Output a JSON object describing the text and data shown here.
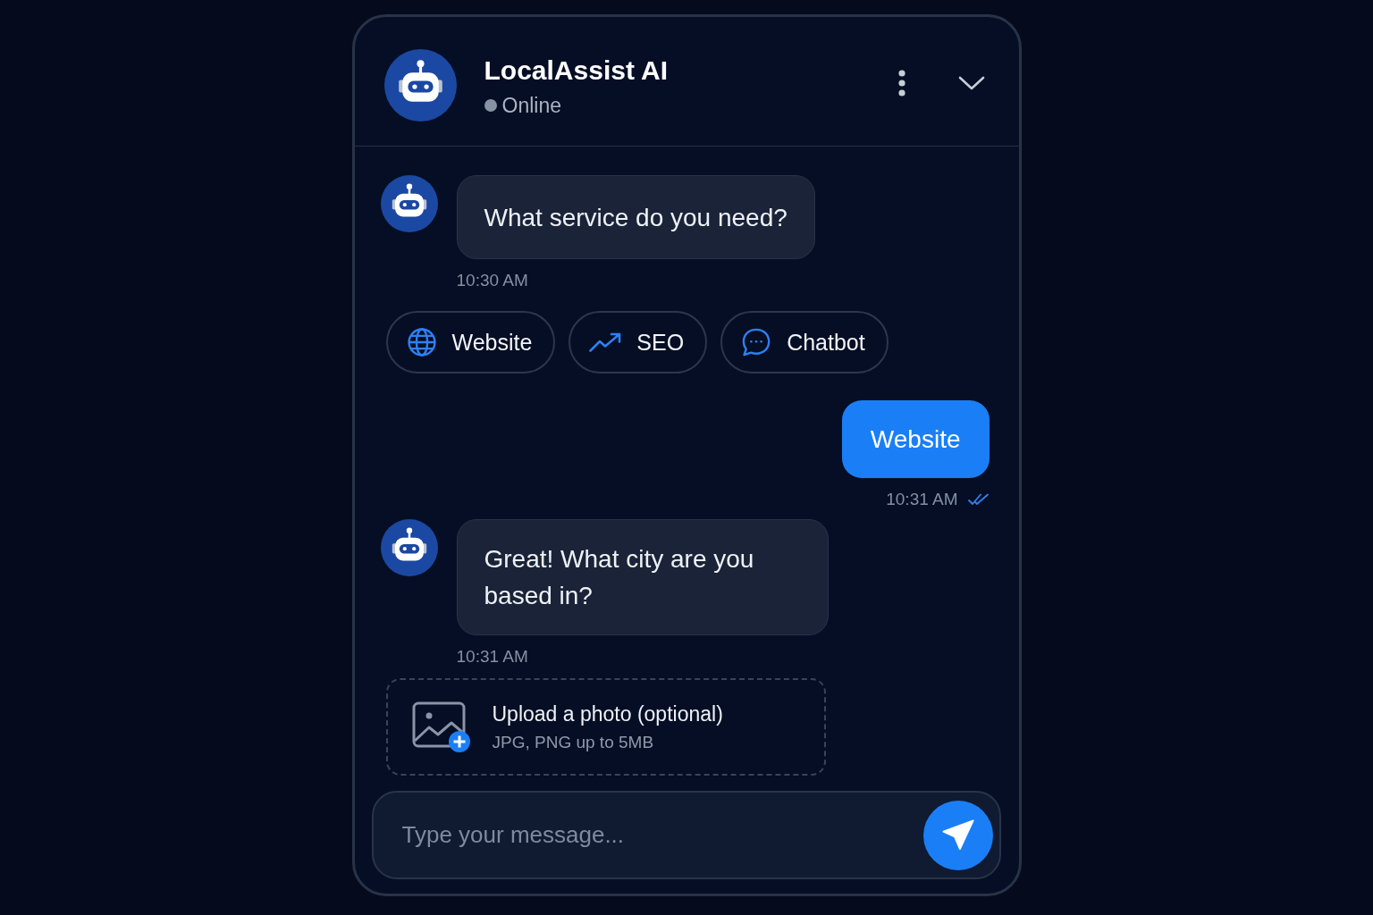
{
  "header": {
    "title": "LocalAssist AI",
    "status": "Online"
  },
  "messages": [
    {
      "kind": "bot",
      "text": "What service do you need?",
      "time": "10:30 AM"
    },
    {
      "kind": "options",
      "options": [
        {
          "label": "Website"
        },
        {
          "label": "SEO"
        },
        {
          "label": "Chatbot"
        }
      ]
    },
    {
      "kind": "user",
      "text": "Website",
      "time": "10:31 AM",
      "read": true
    },
    {
      "kind": "bot",
      "text": "Great! What city are you based in?",
      "time": "10:31 AM"
    },
    {
      "kind": "upload",
      "title": "Upload a photo (optional)",
      "hint": "JPG, PNG up to 5MB"
    }
  ],
  "composer": {
    "placeholder": "Type your message..."
  }
}
